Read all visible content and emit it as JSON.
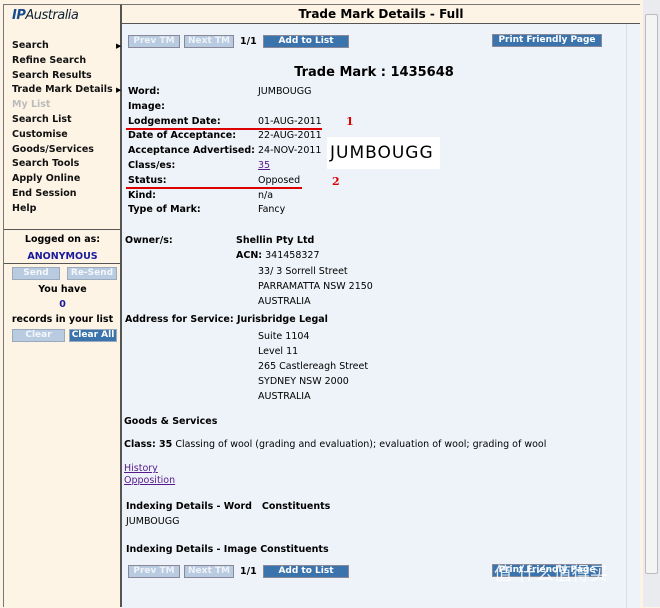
{
  "sidebar": {
    "logo": "IP Australia",
    "logo_a": "IP",
    "logo_b": "Australia",
    "items": [
      {
        "label": "Search",
        "arrow": true
      },
      {
        "label": "Refine Search"
      },
      {
        "label": "Search Results"
      },
      {
        "label": "Trade Mark Details",
        "arrow": true
      },
      {
        "label": "My List",
        "disabled": true
      },
      {
        "label": "Search List"
      },
      {
        "label": "Customise"
      },
      {
        "label": "Goods/Services"
      },
      {
        "label": "Search Tools"
      },
      {
        "label": "Apply Online"
      },
      {
        "label": "End Session"
      },
      {
        "label": "Help"
      }
    ],
    "logged_on_label": "Logged on as:",
    "user": "ANONYMOUS",
    "send": "Send",
    "resend": "Re-Send",
    "you_have": "You have",
    "count": "0",
    "records_label": "records in your list",
    "clear": "Clear",
    "clear_all": "Clear All"
  },
  "header": {
    "title": "Trade Mark Details - Full"
  },
  "toolbar": {
    "prev": "Prev TM",
    "next": "Next TM",
    "page": "1/1",
    "add": "Add to List",
    "print": "Print Friendly Page"
  },
  "tm": {
    "heading": "Trade Mark : 1435648",
    "fields": [
      {
        "label": "Word:",
        "value": "JUMBOUGG"
      },
      {
        "label": "Image:",
        "value": ""
      },
      {
        "label": "Lodgement Date:",
        "value": "01-AUG-2011"
      },
      {
        "label": "Date of Acceptance:",
        "value": "22-AUG-2011"
      },
      {
        "label": "Acceptance Advertised:",
        "value": "24-NOV-2011"
      },
      {
        "label": "Class/es:",
        "value": "35"
      },
      {
        "label": "Status:",
        "value": "Opposed"
      },
      {
        "label": "Kind:",
        "value": "n/a"
      },
      {
        "label": "Type of Mark:",
        "value": "Fancy"
      }
    ],
    "image_text": "JUMBOUGG",
    "annot1": "1",
    "annot2": "2",
    "owner_label": "Owner/s:",
    "owner": "Shellin Pty Ltd",
    "acn_label": "ACN:",
    "acn": "341458327",
    "owner_addr": [
      "33/ 3 Sorrell Street",
      "PARRAMATTA NSW 2150",
      "AUSTRALIA"
    ],
    "afs_label": "Address for Service:",
    "afs": "Jurisbridge Legal",
    "afs_addr": [
      "Suite 1104",
      "Level 11",
      "265 Castlereagh Street",
      "SYDNEY NSW 2000",
      "AUSTRALIA"
    ],
    "gs_heading": "Goods & Services",
    "class_label": "Class: 35",
    "class_text": "Classing of wool (grading and evaluation); evaluation of wool; grading of wool",
    "history": "History",
    "opposition": "Opposition",
    "idx_word": "Indexing Details - Word   Constituents",
    "idx_word_value": "JUMBOUGG",
    "idx_image": "Indexing Details - Image Constituents"
  },
  "watermark": "值 什么值得买"
}
